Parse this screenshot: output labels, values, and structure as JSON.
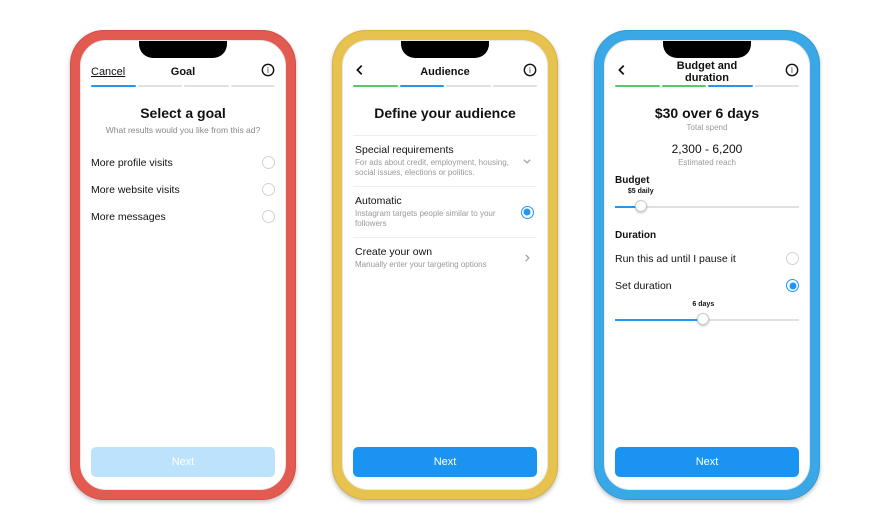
{
  "phones": {
    "goal": {
      "topbar": {
        "left_label": "Cancel",
        "title": "Goal"
      },
      "progress": [
        "blue",
        "gray",
        "gray",
        "gray"
      ],
      "heading": "Select a goal",
      "subheading": "What results would you like from this ad?",
      "options": [
        {
          "label": "More profile visits"
        },
        {
          "label": "More website visits"
        },
        {
          "label": "More messages"
        }
      ],
      "next_label": "Next"
    },
    "audience": {
      "topbar": {
        "title": "Audience"
      },
      "progress": [
        "green",
        "blue",
        "gray",
        "gray"
      ],
      "heading": "Define your audience",
      "rows": {
        "special": {
          "title": "Special requirements",
          "desc": "For ads about credit, employment, housing, social issues, elections or politics."
        },
        "automatic": {
          "title": "Automatic",
          "desc": "Instagram targets people similar to your followers"
        },
        "own": {
          "title": "Create your own",
          "desc": "Manually enter your targeting options"
        }
      },
      "next_label": "Next"
    },
    "budget": {
      "topbar": {
        "title": "Budget and duration"
      },
      "progress": [
        "green",
        "green",
        "blue",
        "gray"
      ],
      "heading": "$30 over 6 days",
      "total_spend_label": "Total spend",
      "reach": "2,300 - 6,200",
      "reach_label": "Estimated reach",
      "budget_label": "Budget",
      "budget_value": "$5 daily",
      "budget_pct": 14,
      "duration_label": "Duration",
      "duration_rows": {
        "pause": {
          "label": "Run this ad until I pause it"
        },
        "setdur": {
          "label": "Set duration"
        }
      },
      "duration_value": "6 days",
      "duration_pct": 48,
      "next_label": "Next"
    }
  }
}
